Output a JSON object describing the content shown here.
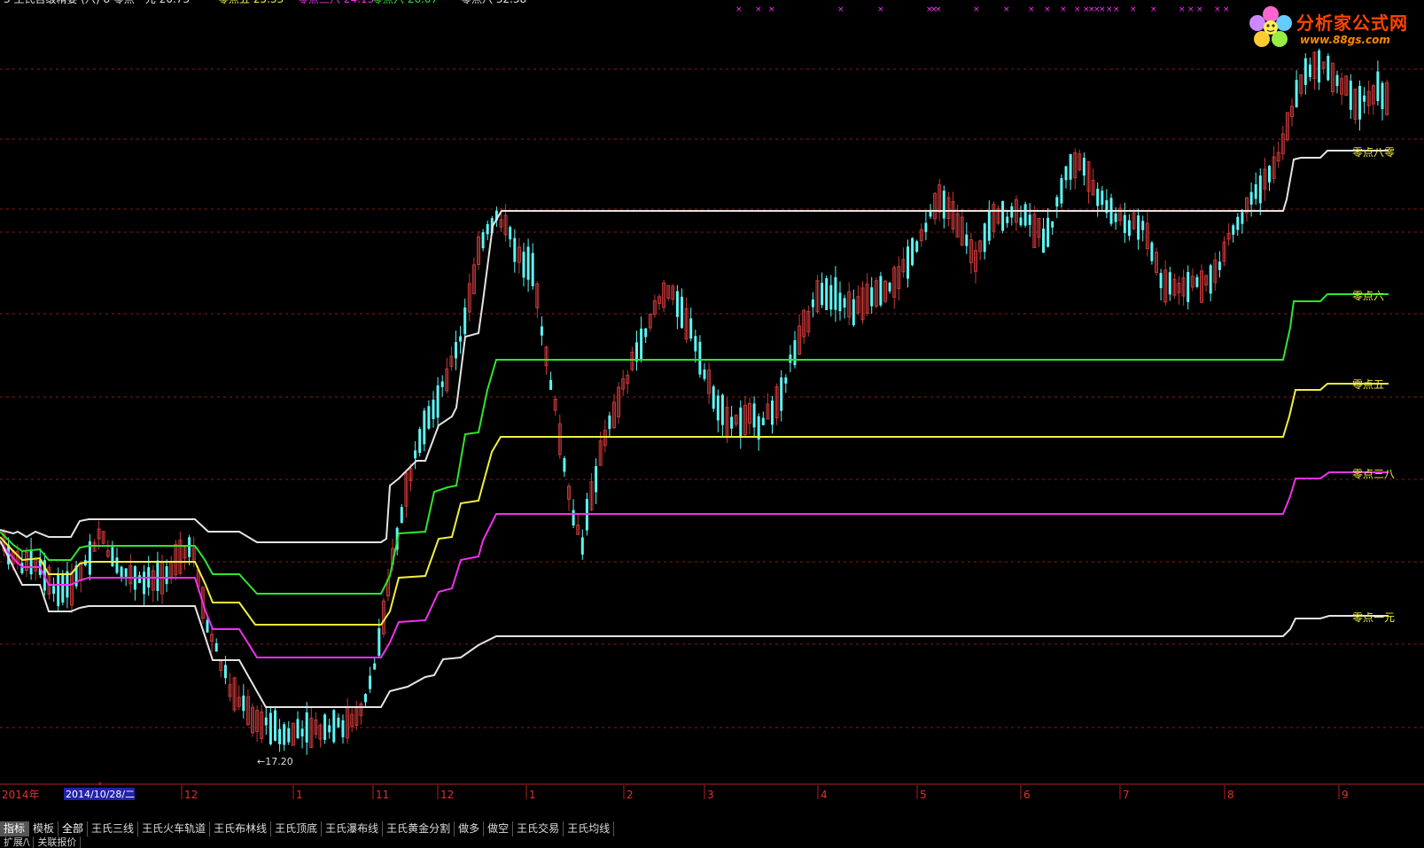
{
  "title_bar": {
    "text_white": "3 王氏百级精要 (八) 8 零点一元 20.73",
    "text_yellow": "零点五 25.33",
    "text_magenta": "零点三八 24.13",
    "text_green": "零点六 26.07",
    "text_white2": "零点八 32.38"
  },
  "logo": {
    "title": "分析家公式网",
    "url": "www.88gs.com"
  },
  "colors": {
    "bg": "#000000",
    "grid": "#8a1a1a",
    "up": "#c63838",
    "down": "#5cf6f6",
    "white_line": "#e4e4e4",
    "green_line": "#2ee62e",
    "yellow_line": "#f0f040",
    "magenta_line": "#f030f0",
    "marker": "#ff30ff"
  },
  "right_labels": [
    {
      "text": "零点八零",
      "color": "#f0f040"
    },
    {
      "text": "零点六",
      "color": "#f0f040"
    },
    {
      "text": "零点五",
      "color": "#f0f040"
    },
    {
      "text": "零点三八",
      "color": "#f0f040"
    },
    {
      "text": "零点一元",
      "color": "#f0f040"
    }
  ],
  "min_label": "←17.20",
  "time_axis": {
    "year": "2014年",
    "cursor_date": "2014/10/28/二",
    "ticks": [
      "12",
      "1",
      "11",
      "12",
      "1",
      "2",
      "3",
      "4",
      "5",
      "6",
      "7",
      "8",
      "9"
    ]
  },
  "tabs": [
    {
      "label": "指标",
      "active": true
    },
    {
      "label": "模板",
      "active": false
    },
    {
      "label": "全部",
      "active": false
    },
    {
      "label": "王氏三线",
      "active": false
    },
    {
      "label": "王氏火车轨道",
      "active": false
    },
    {
      "label": "王氏布林线",
      "active": false
    },
    {
      "label": "王氏顶底",
      "active": false
    },
    {
      "label": "王氏瀑布线",
      "active": false
    },
    {
      "label": "王氏黄金分割",
      "active": false
    },
    {
      "label": "做多",
      "active": false
    },
    {
      "label": "做空",
      "active": false
    },
    {
      "label": "王氏交易",
      "active": false
    },
    {
      "label": "王氏均线",
      "active": false
    }
  ],
  "status": [
    "扩展/\\",
    "关联报价"
  ]
}
